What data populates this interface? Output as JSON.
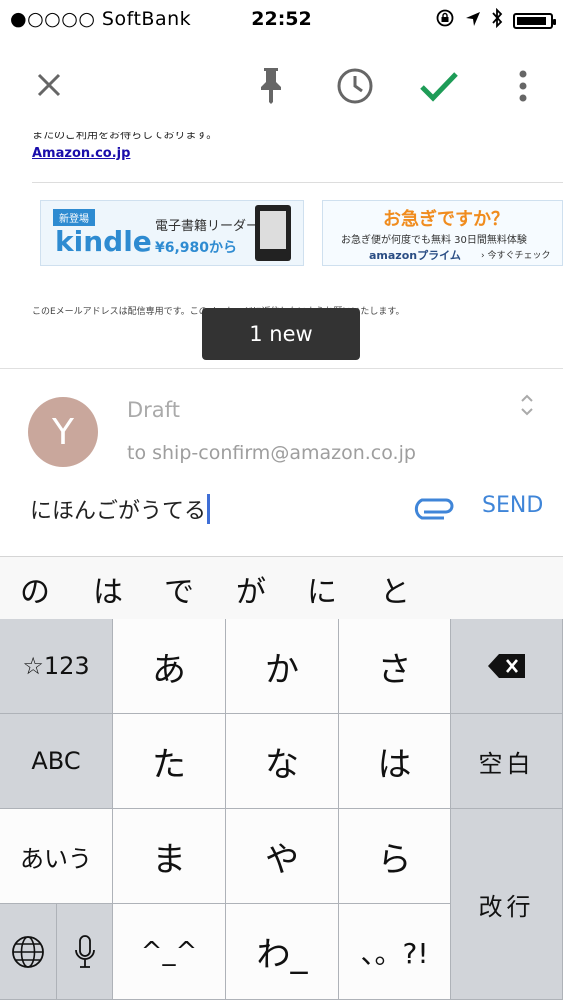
{
  "status_bar": {
    "carrier": "●○○○○ SoftBank",
    "time": "22:52",
    "battery_level": 0.9
  },
  "toolbar": {
    "close_icon": "close-icon",
    "pin_icon": "pin-icon",
    "snooze_icon": "clock-icon",
    "done_icon": "checkmark-icon",
    "more_icon": "more-vertical-icon",
    "colors": {
      "icon": "#666666",
      "check": "#1e9c57"
    }
  },
  "email": {
    "snippet": "またのご利用をお待ちしております。",
    "link": "Amazon.co.jp",
    "banner_kindle": {
      "badge": "新登場",
      "brand": "kindle",
      "title": "電子書籍リーダー",
      "price": "¥6,980から"
    },
    "banner_prime": {
      "headline": "お急ぎですか？",
      "body": "お急ぎ便が何度でも無料 30日間無料体験",
      "brand": "amazonプライム",
      "cta": "› 今すぐチェック"
    },
    "footer_note": "このEメールアドレスは配信専用です。このメッセージに返信しないようお願いいたします。"
  },
  "toast": "1 new",
  "reply": {
    "avatar_initial": "Y",
    "avatar_color": "#c9a79c",
    "draft_label": "Draft",
    "to": "to ship-confirm@amazon.co.jp",
    "compose_text": "にほんごがうてる",
    "send_label": "SEND",
    "accent": "#3f85d8"
  },
  "suggestions": [
    "の",
    "は",
    "で",
    "が",
    "に",
    "と"
  ],
  "keyboard": {
    "num_key": "☆123",
    "abc_key": "ABC",
    "aiu_key": "あいう",
    "row1": [
      "あ",
      "か",
      "さ"
    ],
    "row2": [
      "た",
      "な",
      "は"
    ],
    "row3": [
      "ま",
      "や",
      "ら"
    ],
    "row4": [
      "^_^",
      "わ_",
      "、。?!"
    ],
    "space_key": "空白",
    "return_key": "改行"
  }
}
